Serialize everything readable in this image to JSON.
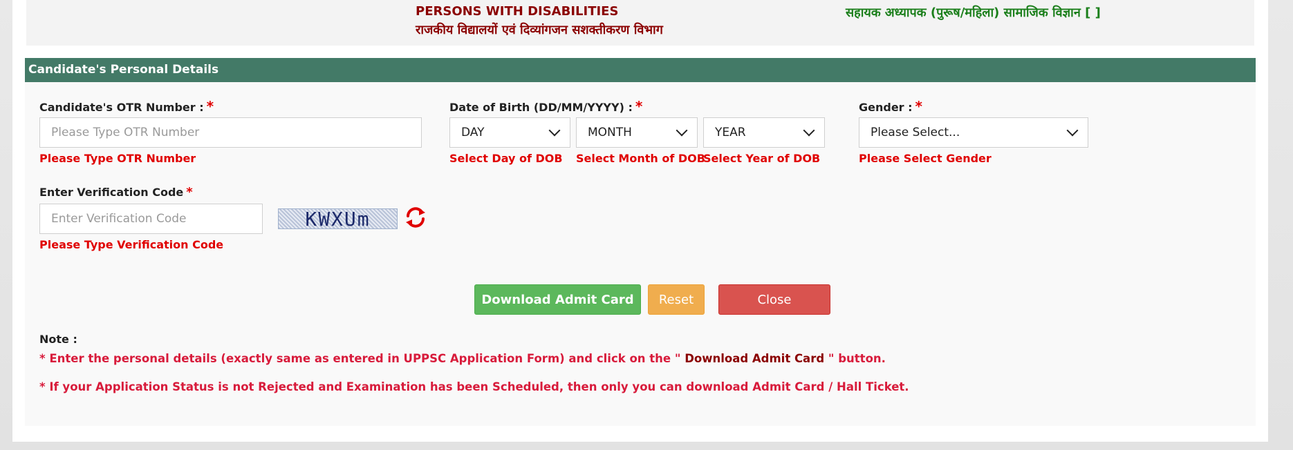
{
  "header": {
    "department_en": "PERSONS WITH DISABILITIES",
    "department_hi": "राजकीय विद्यालयों एवं दिव्यांगजन सशक्तीकरण विभाग",
    "post_title": "सहायक अध्यापक (पुरूष/महिला) सामाजिक विज्ञान [ ]"
  },
  "section": {
    "title": "Candidate's Personal Details"
  },
  "form": {
    "otr": {
      "label": "Candidate's OTR Number :",
      "required_mark": "*",
      "placeholder": "Please Type OTR Number",
      "error": "Please Type OTR Number"
    },
    "dob": {
      "label": "Date of Birth (DD/MM/YYYY) :",
      "required_mark": "*",
      "day": {
        "value": "DAY",
        "error": "Select Day of DOB"
      },
      "month": {
        "value": "MONTH",
        "error": "Select Month of DOB"
      },
      "year": {
        "value": "YEAR",
        "error": "Select Year of DOB"
      }
    },
    "gender": {
      "label": "Gender :",
      "required_mark": "*",
      "value": "Please Select...",
      "error": "Please Select Gender"
    },
    "verification": {
      "label": "Enter Verification Code",
      "required_mark": "*",
      "placeholder": "Enter Verification Code",
      "error": "Please Type Verification Code",
      "captcha_text": "KWXUm"
    }
  },
  "buttons": {
    "download": "Download Admit Card",
    "reset": "Reset",
    "close": "Close"
  },
  "note": {
    "label": "Note :",
    "line1_pre": "* Enter the personal details (exactly same as entered in UPPSC Application Form) and click on the \" ",
    "line1_bold": "Download Admit Card",
    "line1_post": " \" button.",
    "line2": "* If your Application Status is not Rejected and Examination has been Scheduled, then only you can download Admit Card / Hall Ticket."
  },
  "colors": {
    "header_bar": "#437a67",
    "error_red": "#e00000",
    "download_green": "#5cb85c",
    "reset_orange": "#f0ad4e",
    "close_red": "#d9534f"
  },
  "icons": {
    "refresh": "refresh-icon",
    "dropdown": "chevron-down-icon"
  }
}
